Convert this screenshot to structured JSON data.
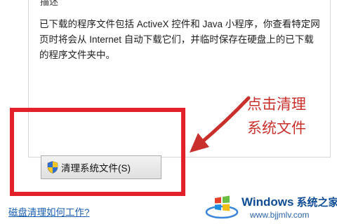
{
  "groupbox": {
    "label": "描述"
  },
  "description": {
    "lines": [
      "已下载的程序文件包括 ActiveX 控件和 Java 小程序，你查看特定网",
      "页时将会从 Internet 自动下载它们，并临时保存在硬盘上的已下载",
      "的程序文件夹中。"
    ]
  },
  "buttons": {
    "cleanup_system_files": "清理系统文件(S)"
  },
  "annotation": {
    "line1": "点击清理",
    "line2": "系统文件",
    "color": "#c9302c"
  },
  "highlight": {
    "color": "#e3212b"
  },
  "links": {
    "how_disk_cleanup_works": "磁盘清理如何工作?"
  },
  "watermark": {
    "brand": "Windows",
    "brand_cn": "系统之家",
    "url": "www.bjjmlv.com"
  },
  "icons": {
    "button_icon": "uac-shield-icon",
    "watermark_logo": "windows-logo-icon"
  }
}
